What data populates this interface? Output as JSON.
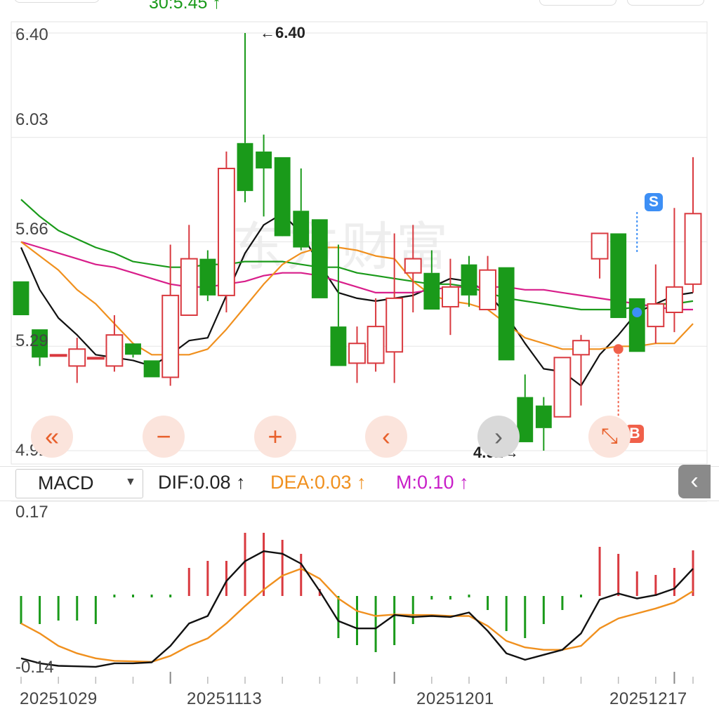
{
  "header": {
    "price_fragment": "30:5.45 ↑"
  },
  "watermark": "东方财富",
  "chart_data": [
    {
      "type": "candlestick",
      "ylim": [
        4.92,
        6.4
      ],
      "y_ticks": [
        "6.40",
        "6.03",
        "5.66",
        "5.29",
        "4.92"
      ],
      "x_tick_labels": [
        "20251029",
        "20251113",
        "20251201",
        "20251217"
      ],
      "high_marker": "←6.40",
      "low_marker": "4.92→",
      "candles": [
        [
          5.52,
          5.52,
          5.4,
          5.4
        ],
        [
          5.35,
          5.35,
          5.22,
          5.25
        ],
        [
          5.26,
          5.26,
          5.26,
          5.26
        ],
        [
          5.22,
          5.32,
          5.16,
          5.28
        ],
        [
          5.25,
          5.25,
          5.25,
          5.25
        ],
        [
          5.22,
          5.4,
          5.2,
          5.33
        ],
        [
          5.3,
          5.3,
          5.25,
          5.26
        ],
        [
          5.24,
          5.24,
          5.18,
          5.18
        ],
        [
          5.18,
          5.65,
          5.15,
          5.47
        ],
        [
          5.4,
          5.72,
          5.4,
          5.6
        ],
        [
          5.6,
          5.63,
          5.45,
          5.47
        ],
        [
          5.47,
          5.98,
          5.41,
          5.92
        ],
        [
          6.01,
          6.4,
          5.8,
          5.84
        ],
        [
          5.98,
          6.04,
          5.75,
          5.92
        ],
        [
          5.96,
          5.96,
          5.69,
          5.68
        ],
        [
          5.77,
          5.92,
          5.63,
          5.64
        ],
        [
          5.74,
          5.74,
          5.46,
          5.46
        ],
        [
          5.36,
          5.65,
          5.22,
          5.22
        ],
        [
          5.23,
          5.36,
          5.16,
          5.3
        ],
        [
          5.23,
          5.46,
          5.2,
          5.36
        ],
        [
          5.27,
          5.69,
          5.16,
          5.46
        ],
        [
          5.55,
          5.72,
          5.41,
          5.6
        ],
        [
          5.55,
          5.63,
          5.42,
          5.42
        ],
        [
          5.43,
          5.6,
          5.33,
          5.5
        ],
        [
          5.58,
          5.61,
          5.43,
          5.47
        ],
        [
          5.42,
          5.61,
          5.42,
          5.56
        ],
        [
          5.57,
          5.57,
          5.24,
          5.24
        ],
        [
          5.11,
          5.19,
          4.95,
          4.95
        ],
        [
          5.08,
          5.11,
          4.92,
          5.0
        ],
        [
          5.04,
          5.25,
          5.04,
          5.25
        ],
        [
          5.26,
          5.33,
          5.08,
          5.31
        ],
        [
          5.6,
          5.6,
          5.53,
          5.69
        ],
        [
          5.69,
          5.69,
          5.39,
          5.39
        ],
        [
          5.46,
          5.46,
          5.27,
          5.27
        ],
        [
          5.36,
          5.58,
          5.3,
          5.44
        ],
        [
          5.41,
          5.78,
          5.34,
          5.5
        ],
        [
          5.51,
          5.96,
          5.48,
          5.76
        ]
      ],
      "ma_lines": [
        {
          "color": "#111111",
          "values": [
            5.64,
            5.49,
            5.39,
            5.33,
            5.26,
            5.25,
            5.24,
            5.22,
            5.26,
            5.31,
            5.32,
            5.47,
            5.62,
            5.72,
            5.76,
            5.69,
            5.58,
            5.48,
            5.46,
            5.45,
            5.46,
            5.47,
            5.5,
            5.53,
            5.52,
            5.48,
            5.4,
            5.3,
            5.21,
            5.2,
            5.15,
            5.26,
            5.33,
            5.41,
            5.44,
            5.47,
            5.48
          ]
        },
        {
          "color": "#1a9a1a",
          "values": [
            5.81,
            5.75,
            5.7,
            5.67,
            5.64,
            5.62,
            5.59,
            5.58,
            5.57,
            5.57,
            5.58,
            5.58,
            5.59,
            5.59,
            5.59,
            5.58,
            5.57,
            5.57,
            5.55,
            5.54,
            5.53,
            5.52,
            5.51,
            5.51,
            5.5,
            5.48,
            5.46,
            5.45,
            5.44,
            5.43,
            5.42,
            5.42,
            5.42,
            5.43,
            5.44,
            5.44,
            5.45
          ]
        },
        {
          "color": "#d81e8a",
          "values": [
            5.66,
            5.64,
            5.62,
            5.6,
            5.58,
            5.57,
            5.55,
            5.53,
            5.51,
            5.5,
            5.5,
            5.51,
            5.52,
            5.54,
            5.55,
            5.55,
            5.54,
            5.52,
            5.5,
            5.48,
            5.48,
            5.48,
            5.49,
            5.5,
            5.5,
            5.5,
            5.5,
            5.49,
            5.49,
            5.48,
            5.47,
            5.46,
            5.45,
            5.44,
            5.43,
            5.42,
            5.42
          ]
        },
        {
          "color": "#f0901e",
          "values": [
            5.66,
            5.61,
            5.56,
            5.49,
            5.44,
            5.37,
            5.3,
            5.26,
            5.26,
            5.26,
            5.28,
            5.35,
            5.43,
            5.51,
            5.58,
            5.62,
            5.64,
            5.64,
            5.63,
            5.61,
            5.6,
            5.52,
            5.47,
            5.45,
            5.44,
            5.42,
            5.37,
            5.32,
            5.3,
            5.28,
            5.28,
            5.28,
            5.29,
            5.29,
            5.3,
            5.3,
            5.37
          ]
        }
      ],
      "buy_marker": "B",
      "sell_marker": "S"
    },
    {
      "type": "macd",
      "title": "MACD",
      "ylim": [
        -0.14,
        0.17
      ],
      "y_ticks": [
        "0.17",
        "-0.14"
      ],
      "dif_label": "DIF:0.08",
      "dea_label": "DEA:0.03",
      "m_label": "M:0.10",
      "arrow": "↑",
      "dif": [
        -0.12,
        -0.13,
        -0.135,
        -0.136,
        -0.137,
        -0.13,
        -0.13,
        -0.128,
        -0.095,
        -0.05,
        -0.035,
        0.035,
        0.075,
        0.095,
        0.09,
        0.07,
        0.015,
        -0.045,
        -0.06,
        -0.06,
        -0.033,
        -0.037,
        -0.035,
        -0.037,
        -0.028,
        -0.065,
        -0.11,
        -0.123,
        -0.113,
        -0.103,
        -0.07,
        -0.002,
        0.01,
        0.0,
        0.007,
        0.02,
        0.06
      ],
      "dea": [
        -0.05,
        -0.07,
        -0.095,
        -0.11,
        -0.12,
        -0.125,
        -0.126,
        -0.127,
        -0.115,
        -0.095,
        -0.08,
        -0.05,
        -0.015,
        0.018,
        0.046,
        0.06,
        0.04,
        0.0,
        -0.025,
        -0.035,
        -0.032,
        -0.033,
        -0.033,
        -0.035,
        -0.035,
        -0.055,
        -0.085,
        -0.098,
        -0.103,
        -0.103,
        -0.095,
        -0.06,
        -0.04,
        -0.03,
        -0.02,
        -0.008,
        0.015
      ],
      "m": [
        -0.04,
        -0.04,
        -0.035,
        -0.035,
        -0.04,
        0.0,
        0.0,
        0.0,
        0.0,
        0.04,
        0.05,
        0.05,
        0.09,
        0.09,
        0.08,
        0.06,
        0.01,
        -0.06,
        -0.07,
        -0.08,
        -0.07,
        -0.04,
        -0.005,
        -0.005,
        0.0,
        -0.02,
        -0.05,
        -0.06,
        -0.04,
        -0.02,
        0.0,
        0.07,
        0.06,
        0.035,
        0.03,
        0.04,
        0.065
      ]
    }
  ],
  "controls": {
    "rewind": "«",
    "zoom_out": "−",
    "zoom_in": "+",
    "prev": "‹",
    "next": "›",
    "expand": "⤡",
    "collapse": "‹"
  }
}
